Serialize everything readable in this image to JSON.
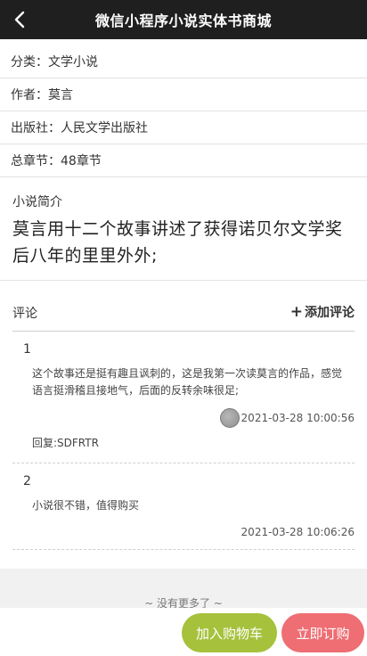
{
  "nav": {
    "title": "微信小程序小说实体书商城"
  },
  "info": [
    {
      "label": "分类",
      "value": "文学小说"
    },
    {
      "label": "作者",
      "value": "莫言"
    },
    {
      "label": "出版社",
      "value": "人民文学出版社"
    },
    {
      "label": "总章节",
      "value": "48章节"
    }
  ],
  "intro": {
    "label": "小说简介",
    "text": "莫言用十二个故事讲述了获得诺贝尔文学奖后八年的里里外外;"
  },
  "comments_section": {
    "label": "评论",
    "add_label": "添加评论"
  },
  "comments": [
    {
      "index": "1",
      "text": "这个故事还是挺有趣且讽刺的，这是我第一次读莫言的作品，感觉语言挺滑稽且接地气，后面的反转余味很足;",
      "time": "2021-03-28 10:00:56",
      "reply": "回复:SDFRTR"
    },
    {
      "index": "2",
      "text": "小说很不错，值得购买",
      "time": "2021-03-28 10:06:26"
    }
  ],
  "footer": {
    "no_more": "~ 没有更多了 ~"
  },
  "actions": {
    "cart_label": "加入购物车",
    "buy_label": "立即订购"
  }
}
